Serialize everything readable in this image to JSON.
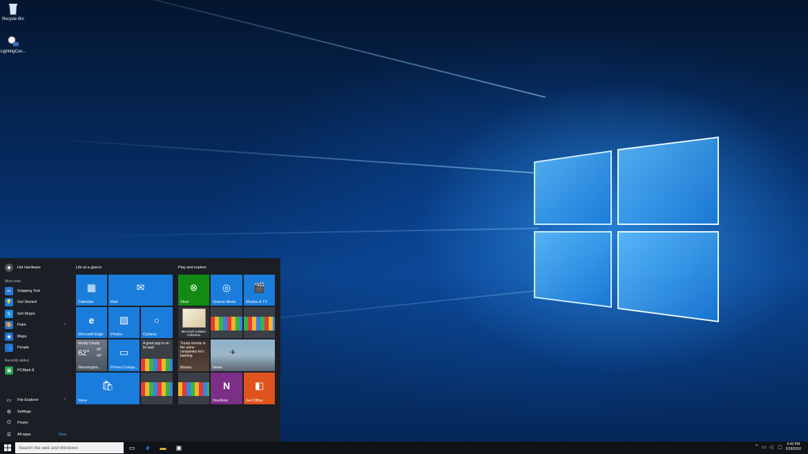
{
  "desktop": {
    "icons": [
      {
        "label": "Recycle Bin",
        "icon": "recycle-bin-icon"
      },
      {
        "label": "LightingCon...",
        "icon": "lighting-control-icon"
      }
    ],
    "colors": {
      "wallpaper": "#0a3f85",
      "glow": "#5ab8ff"
    }
  },
  "start": {
    "user": "Hot Hardware",
    "most_used_heading": "Most used",
    "most_used": [
      {
        "label": "Snipping Tool",
        "icon": "scissors-icon",
        "color": "#2b78d8"
      },
      {
        "label": "Get Started",
        "icon": "lightbulb-icon",
        "color": "#1e7ee0"
      },
      {
        "label": "Get Skype",
        "icon": "skype-icon",
        "color": "#1b8fe0"
      },
      {
        "label": "Paint",
        "icon": "palette-icon",
        "color": "#2c74c9"
      },
      {
        "label": "Maps",
        "icon": "map-pin-icon",
        "color": "#1f6fd0"
      },
      {
        "label": "People",
        "icon": "people-icon",
        "color": "#2a6fc8"
      }
    ],
    "recently_added_heading": "Recently added",
    "recently_added": [
      {
        "label": "PCMark 8",
        "icon": "pcmark-icon",
        "color": "#2aa052"
      }
    ],
    "bottom": [
      {
        "label": "File Explorer",
        "icon": "folder-icon"
      },
      {
        "label": "Settings",
        "icon": "gear-icon"
      },
      {
        "label": "Power",
        "icon": "power-icon"
      },
      {
        "label": "All apps",
        "icon": "list-icon"
      }
    ],
    "new_badge": "New",
    "group1_title": "Life at a glance",
    "group2_title": "Play and explore",
    "tiles": {
      "calendar": "Calendar",
      "mail": "Mail",
      "edge": "Microsoft Edge",
      "photos": "Photos",
      "cortana": "Cortana",
      "weather_cond": "Mostly Cloudy",
      "weather_temp": "62°",
      "weather_hi": "66°",
      "weather_lo": "45°",
      "weather_city": "Washington...",
      "phone": "Phone Compa...",
      "promo_text": "A great app is on its way!",
      "store": "Store",
      "xbox": "Xbox",
      "groove": "Groove Music",
      "movies": "Movies & TV",
      "solitaire": "Microsoft Solitaire Collection",
      "money_headline": "Trump invests in the same companies he's bashing",
      "money": "Money",
      "news": "News",
      "onenote": "OneNote",
      "office": "Get Office"
    }
  },
  "taskbar": {
    "search_placeholder": "Search the web and Windows",
    "time": "6:43 PM",
    "date": "5/18/2016"
  }
}
